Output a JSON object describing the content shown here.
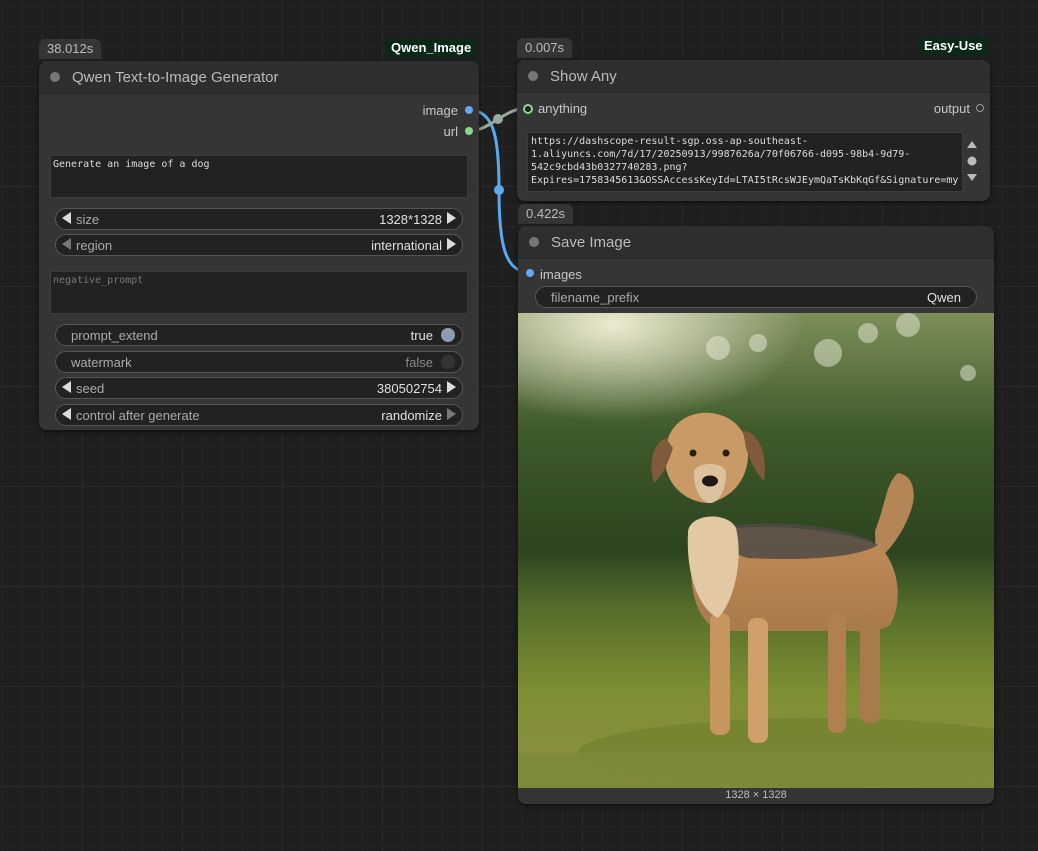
{
  "colors": {
    "image_slot": "#64a8f0",
    "string_slot": "#8ad88a",
    "link_blue": "#5aaaf0",
    "link_grey": "#9aaa9a",
    "tag_bg": "#0a2a17"
  },
  "qwen_node": {
    "timing": "38.012s",
    "tag": "Qwen_Image",
    "title": "Qwen Text-to-Image Generator",
    "outputs": [
      "image",
      "url"
    ],
    "prompt": "Generate an image of a dog",
    "size": {
      "label": "size",
      "value": "1328*1328"
    },
    "region": {
      "label": "region",
      "value": "international"
    },
    "negative_prompt_placeholder": "negative_prompt",
    "prompt_extend": {
      "label": "prompt_extend",
      "value": "true",
      "on": true
    },
    "watermark": {
      "label": "watermark",
      "value": "false",
      "on": false
    },
    "seed": {
      "label": "seed",
      "value": "380502754"
    },
    "control_after_generate": {
      "label": "control after generate",
      "value": "randomize"
    }
  },
  "show_any_node": {
    "timing": "0.007s",
    "tag": "Easy-Use",
    "title": "Show Any",
    "input": "anything",
    "output": "output",
    "text": "https://dashscope-result-sgp.oss-ap-southeast-1.aliyuncs.com/7d/17/20250913/9987626a/70f06766-d095-98b4-9d79-542c9cbd43b0327740283.png?Expires=1758345613&OSSAccessKeyId=LTAI5tRcsWJEymQaTsKbKqGf&Signature=my"
  },
  "save_image_node": {
    "timing": "0.422s",
    "title": "Save Image",
    "input": "images",
    "filename_prefix": {
      "label": "filename_prefix",
      "value": "Qwen"
    },
    "image_caption": "1328 × 1328",
    "image_subject": "dog standing on grass"
  }
}
